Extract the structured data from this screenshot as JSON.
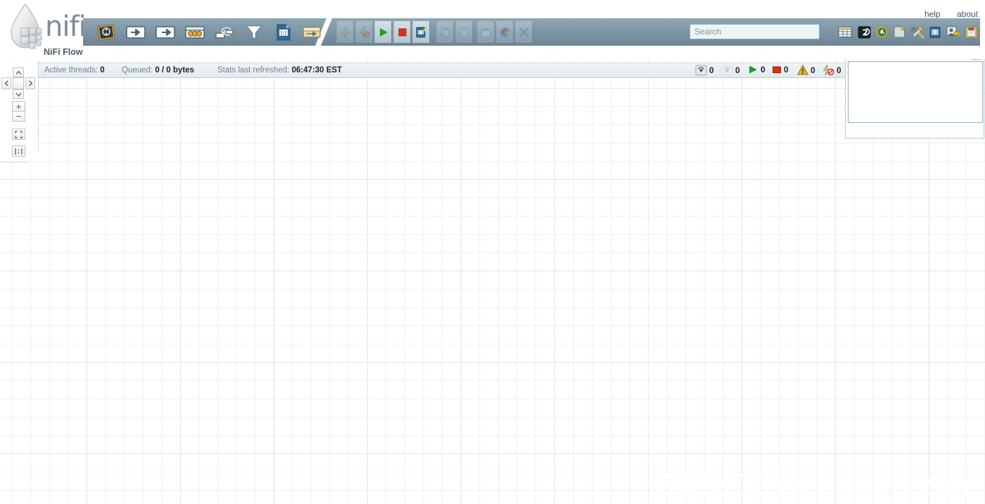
{
  "app": {
    "brand": "nifi",
    "breadcrumb": "NiFi Flow",
    "title": "NiFi Flow"
  },
  "header": {
    "help_label": "help",
    "about_label": "about"
  },
  "search": {
    "placeholder": "Search",
    "value": ""
  },
  "component_toolbar": {
    "items": [
      {
        "name": "processor-icon",
        "label": "Processor"
      },
      {
        "name": "input-port-icon",
        "label": "Input Port"
      },
      {
        "name": "output-port-icon",
        "label": "Output Port"
      },
      {
        "name": "process-group-icon",
        "label": "Process Group"
      },
      {
        "name": "remote-process-group-icon",
        "label": "Remote Process Group"
      },
      {
        "name": "funnel-icon",
        "label": "Funnel"
      },
      {
        "name": "template-icon",
        "label": "Template"
      },
      {
        "name": "label-icon",
        "label": "Label"
      }
    ]
  },
  "action_toolbar": {
    "items": [
      {
        "name": "enable-icon",
        "label": "Enable",
        "enabled": false
      },
      {
        "name": "disable-icon",
        "label": "Disable",
        "enabled": false
      },
      {
        "name": "start-icon",
        "label": "Start",
        "enabled": true
      },
      {
        "name": "stop-icon",
        "label": "Stop",
        "enabled": true
      },
      {
        "name": "template-save-icon",
        "label": "Create Template",
        "enabled": true
      },
      {
        "name": "copy-icon",
        "label": "Copy",
        "enabled": false
      },
      {
        "name": "paste-icon",
        "label": "Paste",
        "enabled": false
      },
      {
        "name": "group-icon",
        "label": "Group",
        "enabled": false
      },
      {
        "name": "color-icon",
        "label": "Change Color",
        "enabled": false
      },
      {
        "name": "delete-icon",
        "label": "Delete",
        "enabled": false
      }
    ]
  },
  "right_toolbar": {
    "items": [
      {
        "name": "summary-icon",
        "label": "Summary"
      },
      {
        "name": "counters-icon",
        "label": "Counters"
      },
      {
        "name": "history-icon",
        "label": "Flow Configuration History"
      },
      {
        "name": "templates-icon",
        "label": "Templates"
      },
      {
        "name": "controller-settings-icon",
        "label": "Controller Settings"
      },
      {
        "name": "bulletin-board-icon",
        "label": "Bulletin Board"
      },
      {
        "name": "users-icon",
        "label": "Users"
      },
      {
        "name": "provenance-icon",
        "label": "Data Provenance"
      }
    ]
  },
  "status_bar": {
    "active_threads_label": "Active threads:",
    "active_threads_value": "0",
    "queued_label": "Queued:",
    "queued_value": "0 / 0 bytes",
    "refreshed_label": "Stats last refreshed:",
    "refreshed_value": "06:47:30 EST",
    "counters": [
      {
        "name": "transmitting-count",
        "icon": "transmitting-icon",
        "value": "0"
      },
      {
        "name": "not-transmitting-count",
        "icon": "not-transmitting-icon",
        "value": "0"
      },
      {
        "name": "running-count",
        "icon": "running-icon",
        "value": "0"
      },
      {
        "name": "stopped-count",
        "icon": "stopped-icon",
        "value": "0"
      },
      {
        "name": "invalid-count",
        "icon": "warning-icon",
        "value": "0"
      },
      {
        "name": "disabled-count",
        "icon": "disabled-icon",
        "value": "0"
      }
    ]
  },
  "navigation": {
    "pan_up": "Pan Up",
    "pan_down": "Pan Down",
    "pan_left": "Pan Left",
    "pan_right": "Pan Right",
    "center": "Center",
    "zoom_in": "+",
    "zoom_out": "−",
    "fit": "Fit Window",
    "actual_size": "Actual Size"
  },
  "birdseye": {
    "label": "Birdseye View",
    "expand_label": "Expand"
  },
  "watermark": {
    "text": "云栖社区 yq.aliyun.com"
  },
  "colors": {
    "toolbar": "#7e97a6",
    "brand_text": "#7c8d96",
    "status_text": "#6f8592",
    "run_green": "#26a128",
    "stop_red": "#d03a28",
    "warn_yellow": "#f0b323"
  }
}
